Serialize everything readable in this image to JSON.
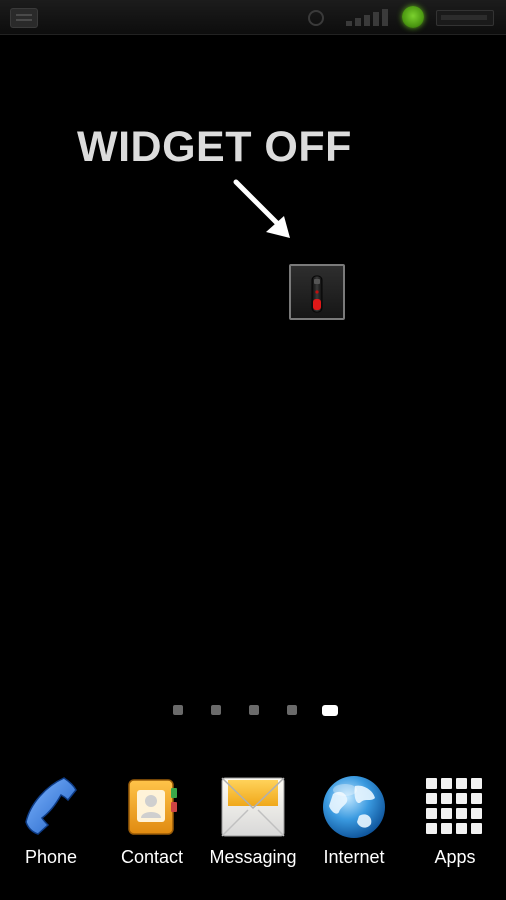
{
  "status_bar": {
    "icons": [
      "notification-icon",
      "mute-icon",
      "signal-icon",
      "network-active-icon",
      "battery-icon"
    ],
    "active_color": "#6cc121"
  },
  "home": {
    "annotation": "WIDGET OFF",
    "widget": {
      "icon": "flashlight-icon",
      "state": "off",
      "accent_color": "#e01818"
    },
    "page_indicator": {
      "total_pages": 5,
      "current_page": 5
    }
  },
  "dock": {
    "items": [
      {
        "label": "Phone",
        "icon": "phone-icon",
        "color": "#3a7fd9"
      },
      {
        "label": "Contact",
        "icon": "contacts-icon",
        "color": "#f0a020"
      },
      {
        "label": "Messaging",
        "icon": "messaging-icon",
        "color": "#f5c44a"
      },
      {
        "label": "Internet",
        "icon": "globe-icon",
        "color": "#2a8ad8"
      },
      {
        "label": "Apps",
        "icon": "apps-grid-icon",
        "color": "#ffffff"
      }
    ]
  }
}
